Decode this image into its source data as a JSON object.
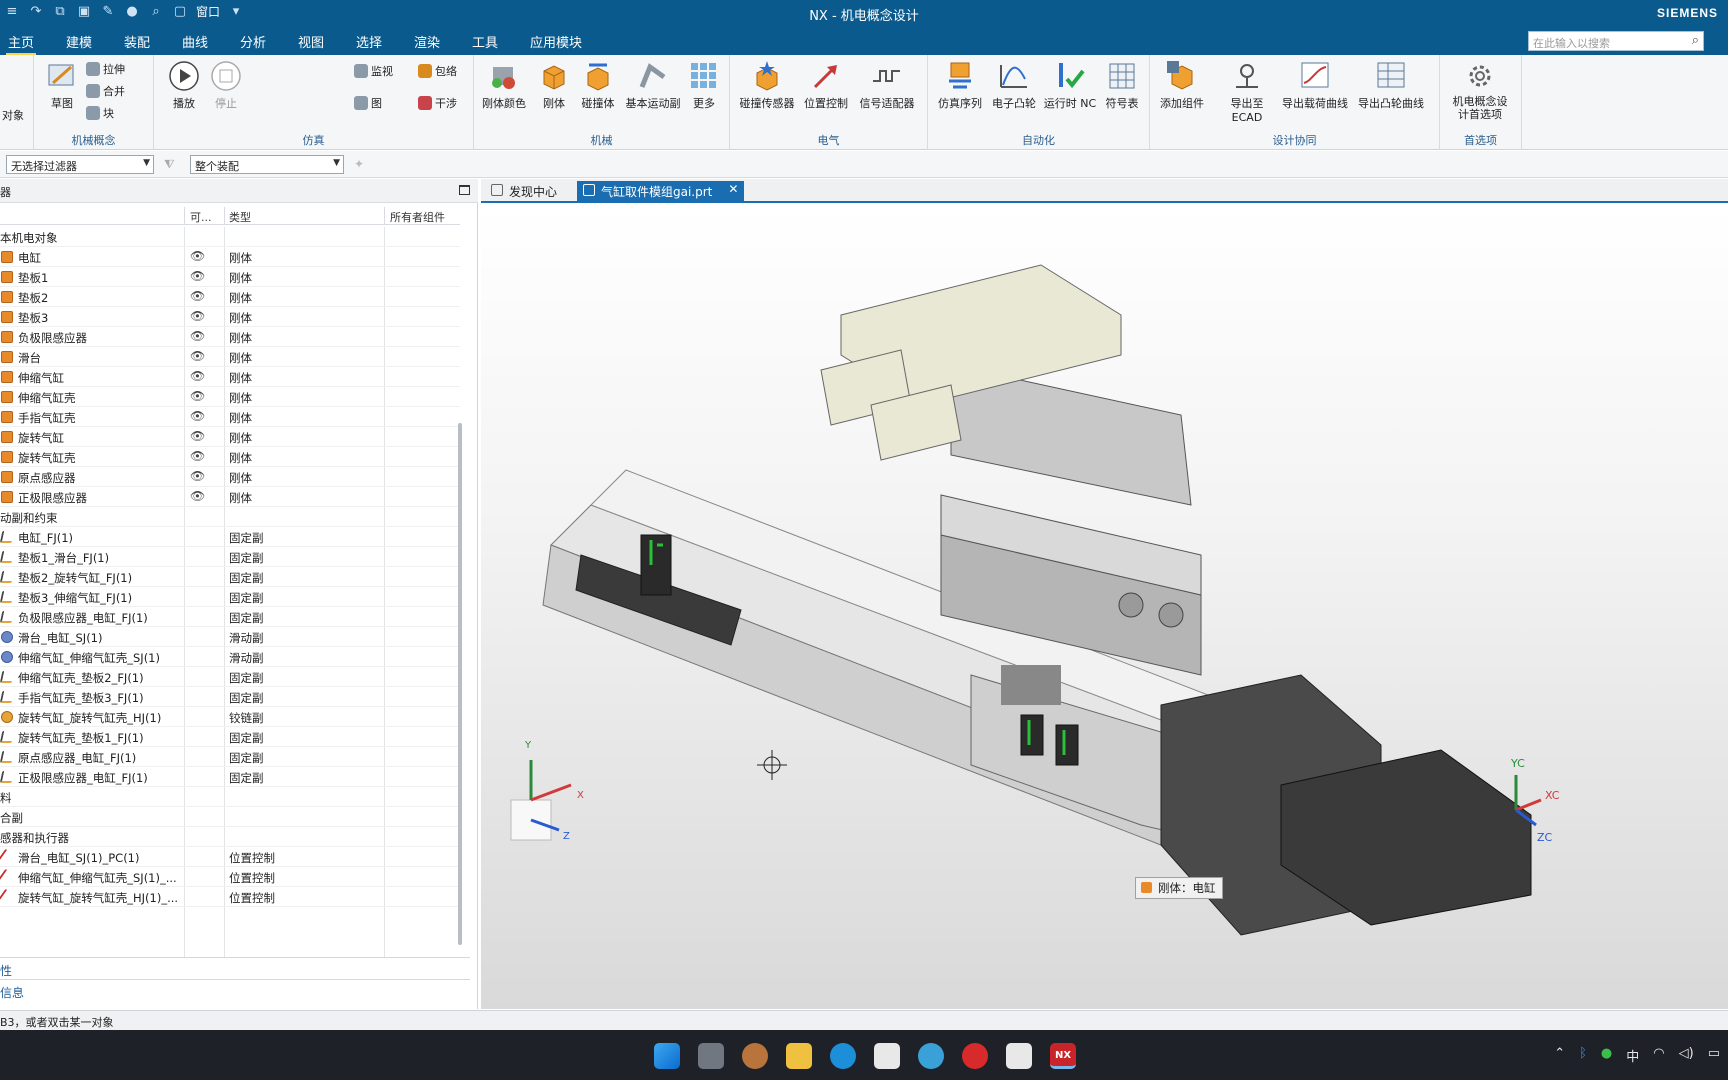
{
  "window": {
    "title": "NX - 机电概念设计",
    "brand": "SIEMENS",
    "qat_window_menu": "窗口"
  },
  "ribbon_tabs": [
    {
      "label": "主页",
      "active": true
    },
    {
      "label": "建模"
    },
    {
      "label": "装配"
    },
    {
      "label": "曲线"
    },
    {
      "label": "分析"
    },
    {
      "label": "视图"
    },
    {
      "label": "选择"
    },
    {
      "label": "渲染"
    },
    {
      "label": "工具"
    },
    {
      "label": "应用模块"
    }
  ],
  "search": {
    "placeholder": "在此输入以搜索"
  },
  "ribbon": {
    "groups": {
      "mech_concept": "机械概念",
      "simulation": "仿真",
      "mechanical": "机械",
      "electrical": "电气",
      "automation": "自动化",
      "design_collab": "设计协同",
      "preferences": "首选项"
    },
    "left_stub": "对象",
    "buttons": {
      "sketch": "草图",
      "extrude": "拉伸",
      "unite": "合并",
      "block": "块",
      "play": "播放",
      "stop": "停止",
      "monitor": "监视",
      "wrap": "包络",
      "graph": "图",
      "interfere": "干涉",
      "body_color": "刚体颜色",
      "rigid_body": "刚体",
      "collision_body": "碰撞体",
      "basic_joint": "基本运动副",
      "more": "更多",
      "collision_sensor": "碰撞传感器",
      "position_control": "位置控制",
      "signal_adapter": "信号适配器",
      "sim_sequence": "仿真序列",
      "e_cam": "电子凸轮",
      "run_nc": "运行时 NC",
      "symbol_table": "符号表",
      "add_component": "添加组件",
      "export_ecad": "导出至 ECAD",
      "export_load_curve": "导出载荷曲线",
      "export_cam_curve": "导出凸轮曲线",
      "prefs": "机电概念设计首选项"
    }
  },
  "filterbar": {
    "filter": "无选择过滤器",
    "scope": "整个装配"
  },
  "navigator": {
    "header": "器",
    "columns": {
      "name": "",
      "visible": "可...",
      "type": "类型",
      "owner": "所有者组件"
    },
    "rows": [
      {
        "kind": "group",
        "name": "本机电对象"
      },
      {
        "kind": "item",
        "icon": "body",
        "name": "电缸",
        "vis": true,
        "type": "刚体"
      },
      {
        "kind": "item",
        "icon": "body",
        "name": "垫板1",
        "vis": true,
        "type": "刚体"
      },
      {
        "kind": "item",
        "icon": "body",
        "name": "垫板2",
        "vis": true,
        "type": "刚体"
      },
      {
        "kind": "item",
        "icon": "body",
        "name": "垫板3",
        "vis": true,
        "type": "刚体"
      },
      {
        "kind": "item",
        "icon": "body",
        "name": "负极限感应器",
        "vis": true,
        "type": "刚体"
      },
      {
        "kind": "item",
        "icon": "body",
        "name": "滑台",
        "vis": true,
        "type": "刚体"
      },
      {
        "kind": "item",
        "icon": "body",
        "name": "伸缩气缸",
        "vis": true,
        "type": "刚体"
      },
      {
        "kind": "item",
        "icon": "body",
        "name": "伸缩气缸壳",
        "vis": true,
        "type": "刚体"
      },
      {
        "kind": "item",
        "icon": "body",
        "name": "手指气缸壳",
        "vis": true,
        "type": "刚体"
      },
      {
        "kind": "item",
        "icon": "body",
        "name": "旋转气缸",
        "vis": true,
        "type": "刚体"
      },
      {
        "kind": "item",
        "icon": "body",
        "name": "旋转气缸壳",
        "vis": true,
        "type": "刚体"
      },
      {
        "kind": "item",
        "icon": "body",
        "name": "原点感应器",
        "vis": true,
        "type": "刚体"
      },
      {
        "kind": "item",
        "icon": "body",
        "name": "正极限感应器",
        "vis": true,
        "type": "刚体"
      },
      {
        "kind": "group",
        "name": "动副和约束"
      },
      {
        "kind": "item",
        "icon": "joint",
        "name": "电缸_FJ(1)",
        "type": "固定副"
      },
      {
        "kind": "item",
        "icon": "joint",
        "name": "垫板1_滑台_FJ(1)",
        "type": "固定副"
      },
      {
        "kind": "item",
        "icon": "joint",
        "name": "垫板2_旋转气缸_FJ(1)",
        "type": "固定副"
      },
      {
        "kind": "item",
        "icon": "joint",
        "name": "垫板3_伸缩气缸_FJ(1)",
        "type": "固定副"
      },
      {
        "kind": "item",
        "icon": "joint",
        "name": "负极限感应器_电缸_FJ(1)",
        "type": "固定副"
      },
      {
        "kind": "item",
        "icon": "slide",
        "name": "滑台_电缸_SJ(1)",
        "type": "滑动副"
      },
      {
        "kind": "item",
        "icon": "slide",
        "name": "伸缩气缸_伸缩气缸壳_SJ(1)",
        "type": "滑动副"
      },
      {
        "kind": "item",
        "icon": "joint",
        "name": "伸缩气缸壳_垫板2_FJ(1)",
        "type": "固定副"
      },
      {
        "kind": "item",
        "icon": "joint",
        "name": "手指气缸壳_垫板3_FJ(1)",
        "type": "固定副"
      },
      {
        "kind": "item",
        "icon": "hinge",
        "name": "旋转气缸_旋转气缸壳_HJ(1)",
        "type": "铰链副"
      },
      {
        "kind": "item",
        "icon": "joint",
        "name": "旋转气缸壳_垫板1_FJ(1)",
        "type": "固定副"
      },
      {
        "kind": "item",
        "icon": "joint",
        "name": "原点感应器_电缸_FJ(1)",
        "type": "固定副"
      },
      {
        "kind": "item",
        "icon": "joint",
        "name": "正极限感应器_电缸_FJ(1)",
        "type": "固定副"
      },
      {
        "kind": "group",
        "name": "料"
      },
      {
        "kind": "group",
        "name": "合副"
      },
      {
        "kind": "group",
        "name": "感器和执行器"
      },
      {
        "kind": "item",
        "icon": "ctrl",
        "name": "滑台_电缸_SJ(1)_PC(1)",
        "type": "位置控制"
      },
      {
        "kind": "item",
        "icon": "ctrl",
        "name": "伸缩气缸_伸缩气缸壳_SJ(1)_...",
        "type": "位置控制"
      },
      {
        "kind": "item",
        "icon": "ctrl",
        "name": "旋转气缸_旋转气缸壳_HJ(1)_...",
        "type": "位置控制"
      }
    ],
    "bottom_sections": [
      "性",
      "信息"
    ]
  },
  "status": {
    "text": "B3，或者双击某一对象"
  },
  "doc_tabs": [
    {
      "label": "发现中心",
      "active": false
    },
    {
      "label": "气缸取件模组gai.prt",
      "active": true
    }
  ],
  "viewport": {
    "tooltip": "刚体：电缸",
    "triad": {
      "x": "X",
      "y": "Y",
      "z": "Z"
    },
    "wcs": {
      "xc": "XC",
      "yc": "YC",
      "zc": "ZC"
    }
  },
  "taskbar": {
    "ime": "中"
  },
  "colors": {
    "titlebar": "#0a5a8e",
    "accent": "#1a6db0",
    "rigid_body_icon": "#e8892a"
  }
}
